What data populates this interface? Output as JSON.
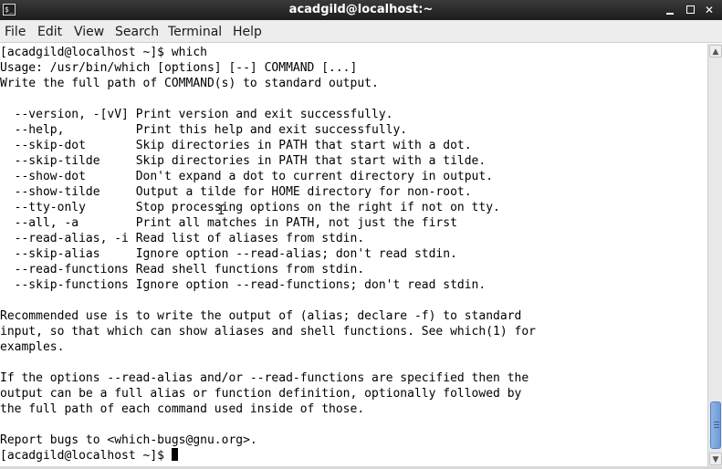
{
  "window": {
    "title": "acadgild@localhost:~",
    "app_icon_glyph": "$_"
  },
  "window_controls": {
    "minimize": "minimize-icon",
    "maximize": "maximize-icon",
    "close_glyph": "✕"
  },
  "menu": {
    "items": [
      "File",
      "Edit",
      "View",
      "Search",
      "Terminal",
      "Help"
    ]
  },
  "terminal": {
    "lines": [
      "[acadgild@localhost ~]$ which",
      "Usage: /usr/bin/which [options] [--] COMMAND [...]",
      "Write the full path of COMMAND(s) to standard output.",
      "",
      "  --version, -[vV] Print version and exit successfully.",
      "  --help,          Print this help and exit successfully.",
      "  --skip-dot       Skip directories in PATH that start with a dot.",
      "  --skip-tilde     Skip directories in PATH that start with a tilde.",
      "  --show-dot       Don't expand a dot to current directory in output.",
      "  --show-tilde     Output a tilde for HOME directory for non-root.",
      "  --tty-only       Stop processing options on the right if not on tty.",
      "  --all, -a        Print all matches in PATH, not just the first",
      "  --read-alias, -i Read list of aliases from stdin.",
      "  --skip-alias     Ignore option --read-alias; don't read stdin.",
      "  --read-functions Read shell functions from stdin.",
      "  --skip-functions Ignore option --read-functions; don't read stdin.",
      "",
      "Recommended use is to write the output of (alias; declare -f) to standard",
      "input, so that which can show aliases and shell functions. See which(1) for",
      "examples.",
      "",
      "If the options --read-alias and/or --read-functions are specified then the",
      "output can be a full alias or function definition, optionally followed by",
      "the full path of each command used inside of those.",
      "",
      "Report bugs to <which-bugs@gnu.org>."
    ],
    "prompt": "[acadgild@localhost ~]$ "
  },
  "scrollbar": {
    "up_glyph": "▲",
    "down_glyph": "▼",
    "position_fraction": 1.0
  }
}
